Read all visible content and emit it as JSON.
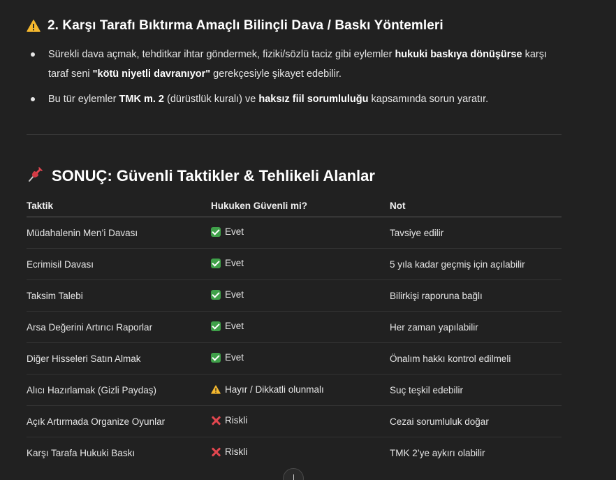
{
  "section": {
    "heading": "2. Karşı Tarafı Bıktırma Amaçlı Bilinçli Dava / Baskı Yöntemleri",
    "heading_icon": "warning-icon",
    "bullets": [
      {
        "parts": [
          {
            "t": "Sürekli dava açmak, tehditkar ihtar göndermek, fiziki/sözlü taciz gibi eylemler ",
            "b": false
          },
          {
            "t": "hukuki baskıya dönüşürse",
            "b": true
          },
          {
            "t": " karşı taraf seni ",
            "b": false
          },
          {
            "t": "\"kötü niyetli davranıyor\"",
            "b": true
          },
          {
            "t": " gerekçesiyle şikayet edebilir.",
            "b": false
          }
        ]
      },
      {
        "parts": [
          {
            "t": "Bu tür eylemler ",
            "b": false
          },
          {
            "t": "TMK m. 2",
            "b": true
          },
          {
            "t": " (dürüstlük kuralı) ve ",
            "b": false
          },
          {
            "t": "haksız fiil sorumluluğu",
            "b": true
          },
          {
            "t": " kapsamında sorun yaratır.",
            "b": false
          }
        ]
      }
    ]
  },
  "summary": {
    "heading": "SONUÇ: Güvenli Taktikler & Tehlikeli Alanlar",
    "heading_icon": "pushpin-icon"
  },
  "table": {
    "headers": [
      "Taktik",
      "Hukuken Güvenli mi?",
      "Not"
    ],
    "rows": [
      {
        "taktik": "Müdahalenin Men’i Davası",
        "icon": "check-icon",
        "status": "Evet",
        "not": "Tavsiye edilir"
      },
      {
        "taktik": "Ecrimisil Davası",
        "icon": "check-icon",
        "status": "Evet",
        "not": "5 yıla kadar geçmiş için açılabilir"
      },
      {
        "taktik": "Taksim Talebi",
        "icon": "check-icon",
        "status": "Evet",
        "not": "Bilirkişi raporuna bağlı"
      },
      {
        "taktik": "Arsa Değerini Artırıcı Raporlar",
        "icon": "check-icon",
        "status": "Evet",
        "not": "Her zaman yapılabilir"
      },
      {
        "taktik": "Diğer Hisseleri Satın Almak",
        "icon": "check-icon",
        "status": "Evet",
        "not": "Önalım hakkı kontrol edilmeli"
      },
      {
        "taktik": "Alıcı Hazırlamak (Gizli Paydaş)",
        "icon": "warning-icon",
        "status": "Hayır / Dikkatli olunmalı",
        "not": "Suç teşkil edebilir"
      },
      {
        "taktik": "Açık Artırmada Organize Oyunlar",
        "icon": "cross-icon",
        "status": "Riskli",
        "not": "Cezai sorumluluk doğar"
      },
      {
        "taktik": "Karşı Tarafa Hukuki Baskı",
        "icon": "cross-icon",
        "status": "Riskli",
        "not": "TMK 2’ye aykırı olabilir"
      }
    ]
  },
  "colors": {
    "background": "#212121",
    "text": "#ececec",
    "check": "#3fa049",
    "warning": "#f5b82e",
    "cross": "#e2474f"
  },
  "scroll_button_icon": "arrow-down-icon"
}
